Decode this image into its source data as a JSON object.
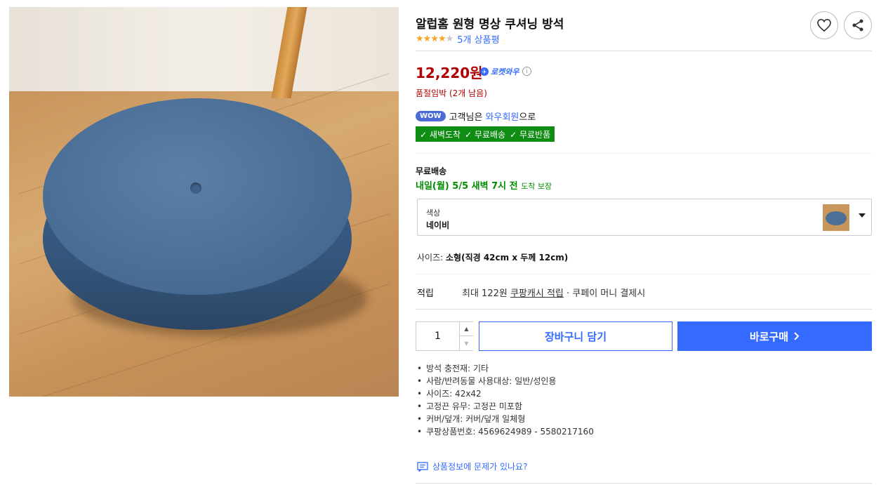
{
  "product": {
    "title": "알럽홈 원형 명상 쿠셔닝 방석",
    "rating": 4,
    "rating_max": 5,
    "review_count": "5개 상품평",
    "price": "12,220원",
    "rocket_label": "로켓와우",
    "stock_notice": "품절임박 (2개 남음)"
  },
  "icons": {
    "heart": "heart-icon",
    "share": "share-icon",
    "info": "info-icon",
    "check": "check-icon",
    "caret": "caret-down-icon",
    "chevron": "chevron-right-icon",
    "chat": "chat-icon"
  },
  "wow": {
    "badge": "WOW",
    "text_before": "고객님은",
    "member": "와우회원",
    "text_after": "으로",
    "benefits": [
      "새벽도착",
      "무료배송",
      "무료반품"
    ]
  },
  "shipping": {
    "label": "무료배송",
    "date": "내일(월) 5/5 새벽 7시 전",
    "guarantee": "도착 보장"
  },
  "option": {
    "label": "색상",
    "value": "네이비"
  },
  "size": {
    "label": "사이즈:",
    "value": "소형(직경 42cm x 두께 12cm)"
  },
  "reward": {
    "label": "적립",
    "prefix": "최대 122원",
    "cash": "쿠팡캐시 적립",
    "suffix": "· 쿠페이 머니 결제시"
  },
  "purchase": {
    "quantity": "1",
    "cart_label": "장바구니 담기",
    "buy_label": "바로구매"
  },
  "attributes": [
    "방석 충전재: 기타",
    "사람/반려동물 사용대상: 일반/성인용",
    "사이즈: 42x42",
    "고정끈 유무: 고정끈 미포함",
    "커버/덮개: 커버/덮개 일체형",
    "쿠팡상품번호: 4569624989 - 5580217160"
  ],
  "report_link": "상품정보에 문제가 있나요?",
  "colors": {
    "accent": "#346aff",
    "price": "#ae0000",
    "benefit_bg": "#0f8d12",
    "arrival": "#008c00",
    "star": "#f6a623"
  }
}
